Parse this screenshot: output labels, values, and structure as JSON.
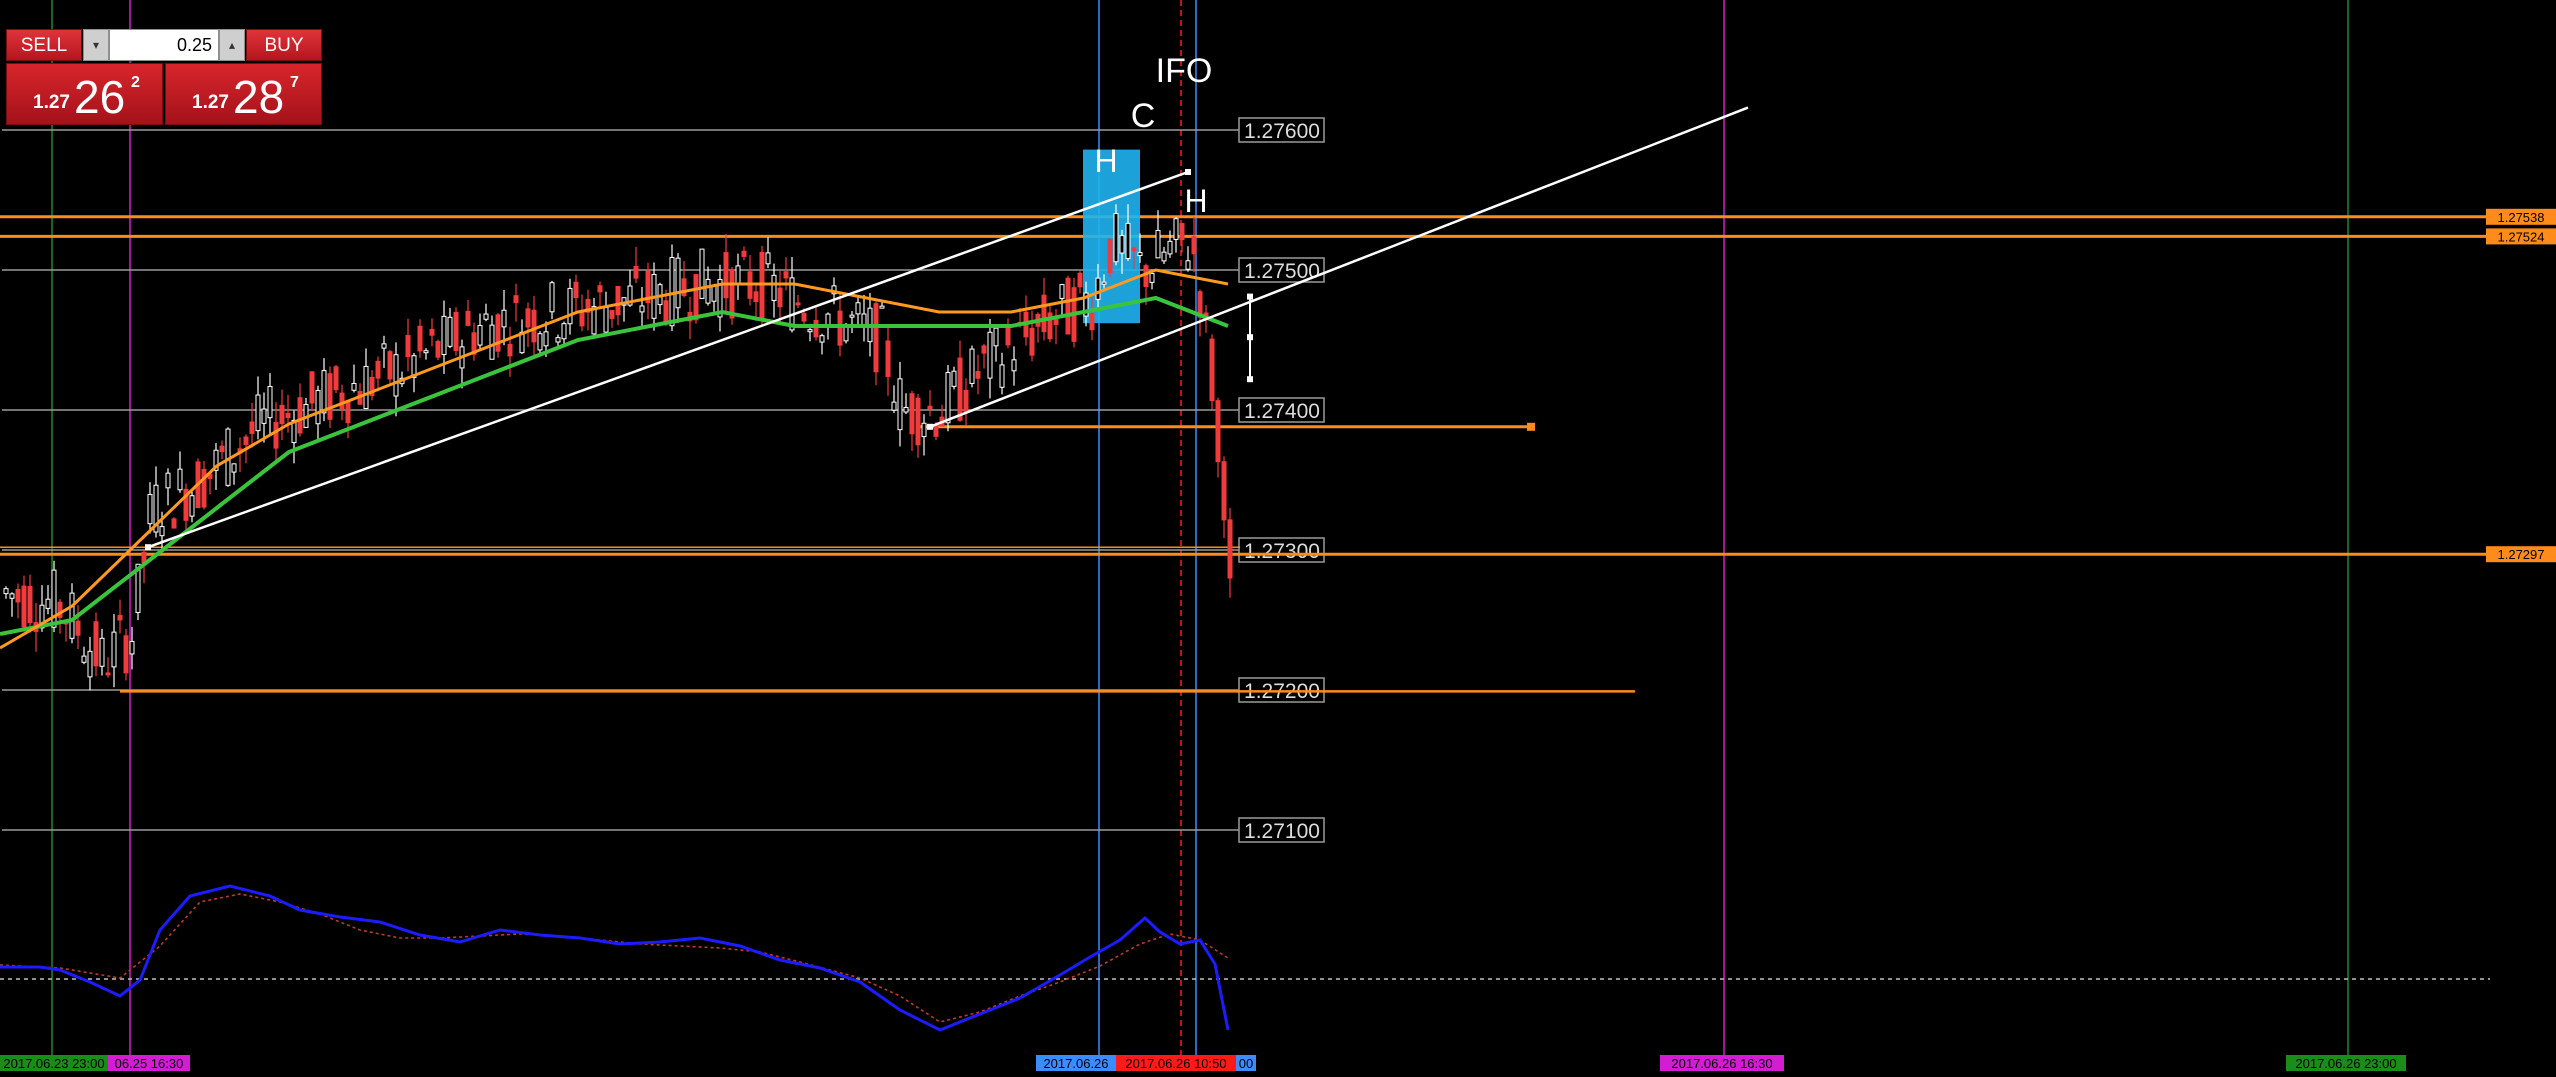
{
  "colors": {
    "background": "#000000",
    "bull_candle": "#ffffff",
    "bear_candle": "#ef3b3b",
    "ema_fast": "#ff9a1f",
    "ema_slow": "#39c43c",
    "level_line": "#ff8c1a",
    "grid_line": "#9a9a9a",
    "oscillator_main": "#1c1cff",
    "oscillator_signal": "#c0392b",
    "session_magenta": "#d41cd4",
    "session_green": "#1a8c1a",
    "session_blue": "#3a8cff",
    "session_red": "#ff1a1a",
    "highlight_box": "#1fb4f0"
  },
  "trade_panel": {
    "sell_label": "SELL",
    "buy_label": "BUY",
    "volume": "0.25",
    "bid": {
      "small": "1.27",
      "big": "26",
      "sup": "2"
    },
    "ask": {
      "small": "1.27",
      "big": "28",
      "sup": "7"
    },
    "spin_down_icon": "down-arrow-icon",
    "spin_up_icon": "up-arrow-icon"
  },
  "chart_data": {
    "type": "candlestick",
    "ylim": [
      1.2703,
      1.2783
    ],
    "price_levels": [
      "1.27600",
      "1.27500",
      "1.27400",
      "1.27300",
      "1.27200",
      "1.27100"
    ],
    "level_tags": [
      "1.27538",
      "1.27524",
      "1.27297"
    ],
    "pattern_labels": [
      "IFO",
      "C",
      "H",
      "H"
    ],
    "time_labels": [
      "2017.06.23 23:00",
      "06.25 16:30",
      "2017.06.26",
      "2017.06.26 10:50",
      "00",
      "2017.06.26 16:30",
      "2017.06.26 23:00"
    ],
    "oscillator_zero": 0,
    "ema_fast": [
      1.2723,
      1.2726,
      1.2731,
      1.2736,
      1.2739,
      1.2741,
      1.2743,
      1.2745,
      1.2747,
      1.2748,
      1.2749,
      1.2749,
      1.2748,
      1.2747,
      1.2747,
      1.2748,
      1.275,
      1.2749
    ],
    "ema_slow": [
      1.2724,
      1.2725,
      1.2729,
      1.2733,
      1.2737,
      1.2739,
      1.2741,
      1.2743,
      1.2745,
      1.2746,
      1.2747,
      1.2746,
      1.2746,
      1.2746,
      1.2746,
      1.2747,
      1.2748,
      1.2746
    ]
  }
}
